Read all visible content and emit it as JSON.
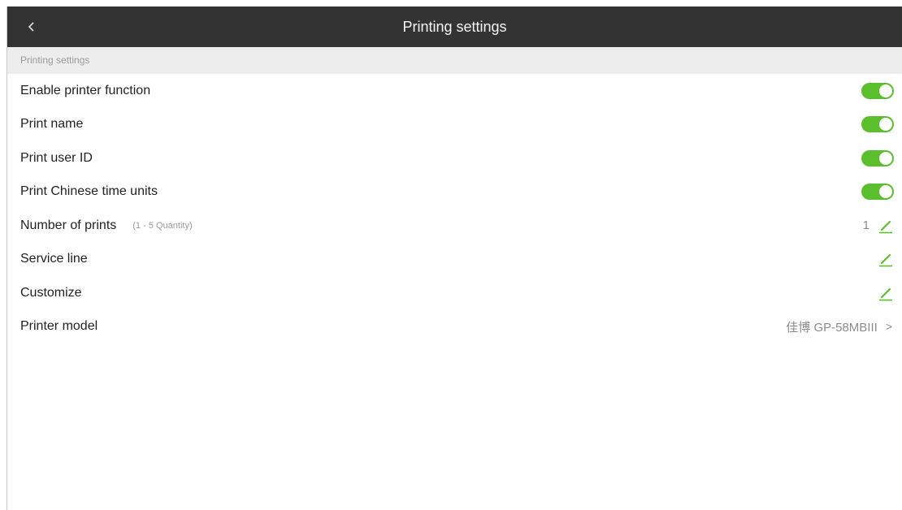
{
  "topbar": {
    "back_icon": "chevron-left-icon",
    "title": "Printing settings"
  },
  "section": {
    "header": "Printing settings"
  },
  "settings": {
    "enable_printer": {
      "label": "Enable printer function",
      "enabled": true
    },
    "print_name": {
      "label": "Print name",
      "enabled": true
    },
    "print_user_id": {
      "label": "Print user ID",
      "enabled": true
    },
    "print_chinese_time": {
      "label": "Print Chinese time units",
      "enabled": true
    },
    "number_of_prints": {
      "label": "Number of prints",
      "hint": "(1 - 5 Quantity)",
      "value": "1",
      "icon": "edit-pencil-icon"
    },
    "service_line": {
      "label": "Service line",
      "icon": "edit-pencil-icon"
    },
    "customize": {
      "label": "Customize",
      "icon": "edit-pencil-icon"
    },
    "printer_model": {
      "label": "Printer model",
      "value": "佳博 GP-58MBIII",
      "chevron": ">"
    }
  },
  "colors": {
    "topbar_bg": "#333333",
    "section_bg": "#ededed",
    "toggle_on": "#5bbf2d",
    "edit_icon": "#5bbf2d"
  }
}
